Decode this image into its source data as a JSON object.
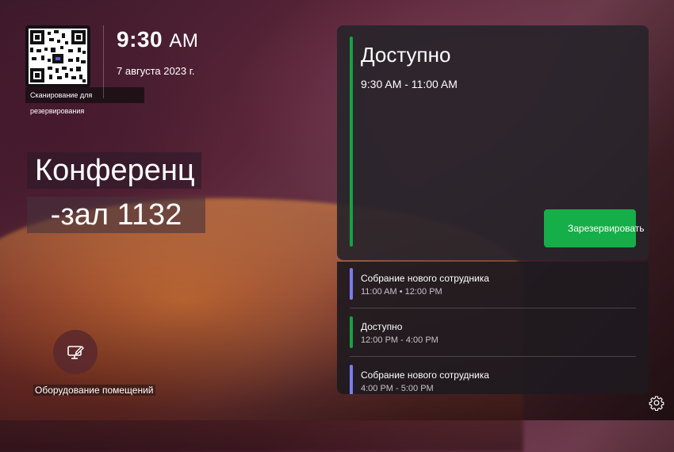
{
  "clock": {
    "time": "9:30",
    "ampm": "AM",
    "date": "7 августа 2023 г."
  },
  "qr": {
    "caption": "Сканирование для резервирования"
  },
  "room": {
    "line1": "Конференц",
    "line2": "-зал 1132"
  },
  "equipment": {
    "label": "Оборудование помещений"
  },
  "current": {
    "status": "Доступно",
    "range": "9:30 AM - 11:00 AM",
    "reserve_label": "Зарезервировать",
    "accent": "#13a441"
  },
  "schedule": [
    {
      "title": "Собрание нового сотрудника",
      "time": "11:00 AM • 12:00 PM",
      "color": "#7b7bf0"
    },
    {
      "title": "Доступно",
      "time": "12:00 PM - 4:00 PM",
      "color": "#13a441"
    },
    {
      "title": "Собрание нового сотрудника",
      "time": "4:00 PM - 5:00 PM",
      "color": "#7b7bf0"
    }
  ]
}
